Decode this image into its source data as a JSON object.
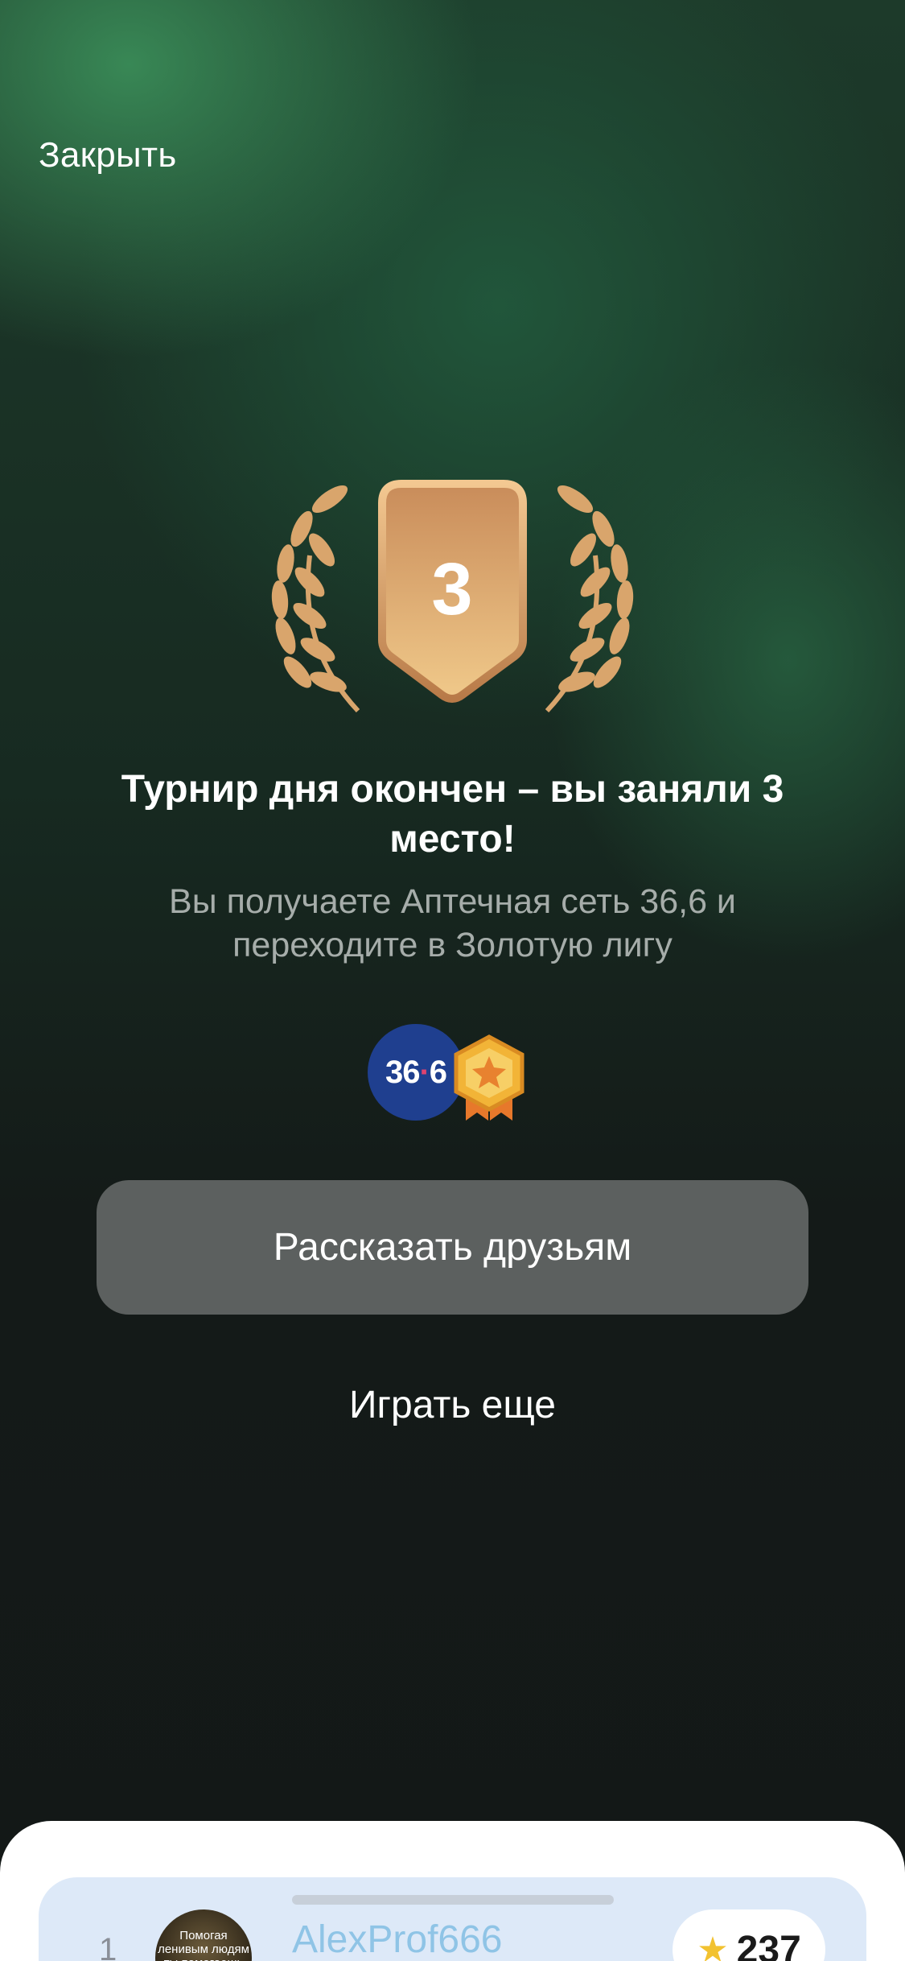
{
  "header": {
    "close_label": "Закрыть"
  },
  "badge": {
    "place": "3"
  },
  "result": {
    "title": "Турнир дня окончен – вы заняли 3 место!",
    "subtitle": "Вы получаете Аптечная сеть 36,6 и переходите в Золотую лигу"
  },
  "rewards": {
    "partner_logo_text_a": "36",
    "partner_logo_dot": "·",
    "partner_logo_text_b": "6",
    "league_icon": "gold-league-badge-icon"
  },
  "actions": {
    "share_label": "Рассказать друзьям",
    "play_again_label": "Играть еще"
  },
  "leaderboard": {
    "rows": [
      {
        "rank": "1",
        "avatar_text": "Помогая ленивым людям ты помогаешь им",
        "username": "AlexProf666",
        "score": "237"
      }
    ]
  },
  "colors": {
    "laurel_gold": "#d8a56a",
    "share_button_bg": "#5c605f",
    "partner_blue": "#1f3f8f",
    "leaderboard_row_bg": "#dde9f8"
  }
}
